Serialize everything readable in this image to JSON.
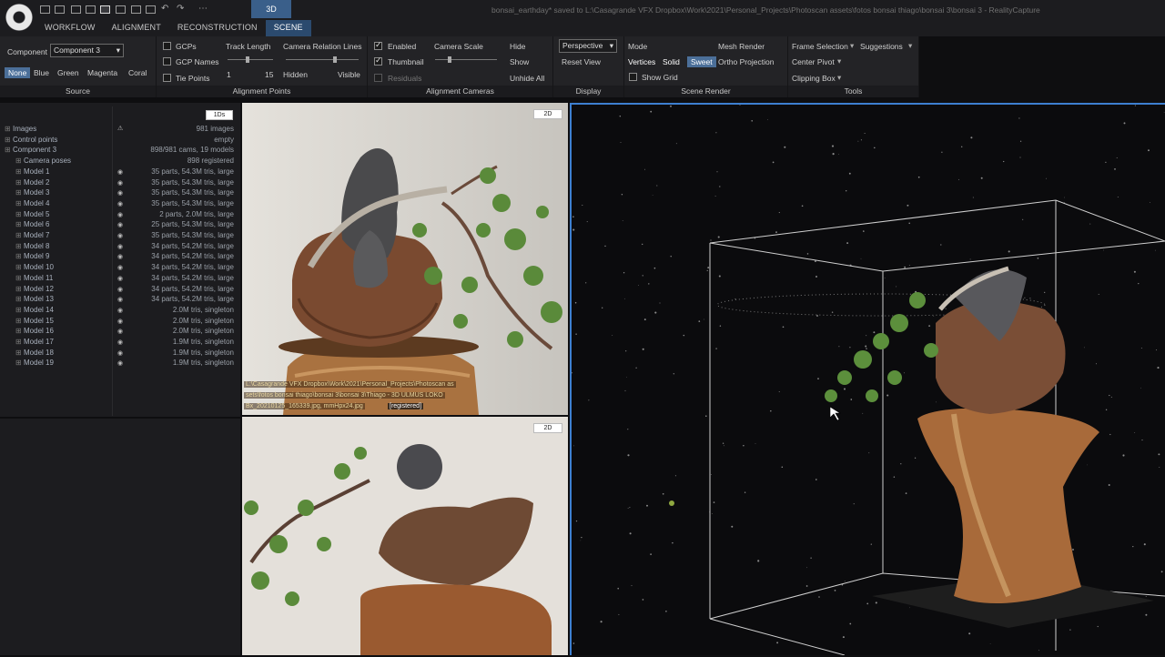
{
  "app": {
    "window_title": "bonsai_earthday* saved to L:\\Casagrande VFX Dropbox\\Work\\2021\\Personal_Projects\\Photoscan assets\\fotos bonsai thiago\\bonsai 3\\bonsai 3 - RealityCapture",
    "tabs": [
      "WORKFLOW",
      "ALIGNMENT",
      "RECONSTRUCTION",
      "SCENE"
    ],
    "active_tab": "SCENE",
    "view_mode": "3D"
  },
  "ribbon": {
    "source": {
      "component_label": "Component",
      "component_value": "Component 3",
      "colors": [
        "None",
        "Blue",
        "Green",
        "Magenta",
        "Coral"
      ],
      "group_label": "Source"
    },
    "alignment_points": {
      "gcps": "GCPs",
      "gcp_names": "GCP Names",
      "tie_points": "Tie Points",
      "track_length": "Track Length",
      "track_min": "1",
      "track_max": "15",
      "camera_relation_lines": "Camera Relation Lines",
      "hidden": "Hidden",
      "visible": "Visible",
      "group_label": "Alignment Points"
    },
    "alignment_cameras": {
      "enabled": "Enabled",
      "thumbnail": "Thumbnail",
      "residuals": "Residuals",
      "camera_scale": "Camera Scale",
      "hide": "Hide",
      "show": "Show",
      "unhide_all": "Unhide All",
      "group_label": "Alignment Cameras"
    },
    "display": {
      "projection": "Perspective",
      "reset_view": "Reset View",
      "group_label": "Display"
    },
    "scene_render": {
      "mode": "Mode",
      "mesh_render": "Mesh Render",
      "vertices": "Vertices",
      "solid": "Solid",
      "sweet": "Sweet",
      "ortho_projection": "Ortho Projection",
      "show_grid": "Show Grid",
      "group_label": "Scene Render"
    },
    "tools": {
      "frame_selection": "Frame Selection",
      "suggestions": "Suggestions",
      "center_pivot": "Center Pivot",
      "clipping_box": "Clipping Box",
      "group_label": "Tools"
    }
  },
  "tree": {
    "badge": "1Ds",
    "rows": [
      {
        "label": "Images",
        "value": "981 images"
      },
      {
        "label": "Control points",
        "value": "empty"
      },
      {
        "label": "Component 3",
        "value": "898/981 cams, 19 models"
      },
      {
        "label": "Camera poses",
        "value": "898 registered"
      },
      {
        "label": "Model 1",
        "value": "35 parts, 54.3M tris, large"
      },
      {
        "label": "Model 2",
        "value": "35 parts, 54.3M tris, large"
      },
      {
        "label": "Model 3",
        "value": "35 parts, 54.3M tris, large"
      },
      {
        "label": "Model 4",
        "value": "35 parts, 54.3M tris, large"
      },
      {
        "label": "Model 5",
        "value": "2 parts, 2.0M tris, large"
      },
      {
        "label": "Model 6",
        "value": "25 parts, 54.3M tris, large"
      },
      {
        "label": "Model 7",
        "value": "35 parts, 54.3M tris, large"
      },
      {
        "label": "Model 8",
        "value": "34 parts, 54.2M tris, large"
      },
      {
        "label": "Model 9",
        "value": "34 parts, 54.2M tris, large"
      },
      {
        "label": "Model 10",
        "value": "34 parts, 54.2M tris, large"
      },
      {
        "label": "Model 11",
        "value": "34 parts, 54.2M tris, large"
      },
      {
        "label": "Model 12",
        "value": "34 parts, 54.2M tris, large"
      },
      {
        "label": "Model 13",
        "value": "34 parts, 54.2M tris, large"
      },
      {
        "label": "Model 14",
        "value": "2.0M tris, singleton"
      },
      {
        "label": "Model 15",
        "value": "2.0M tris, singleton"
      },
      {
        "label": "Model 16",
        "value": "2.0M tris, singleton"
      },
      {
        "label": "Model 17",
        "value": "1.9M tris, singleton"
      },
      {
        "label": "Model 18",
        "value": "1.9M tris, singleton"
      },
      {
        "label": "Model 19",
        "value": "1.9M tris, singleton"
      }
    ]
  },
  "viewports": {
    "top_2d_badge": "2D",
    "bottom_2d_badge": "2D",
    "image_path_line1": "L:\\Casagrande VFX Dropbox\\Work\\2021\\Personal_Projects\\Photoscan as",
    "image_path_line2": "sets\\fotos bonsai thiago\\bonsai 3\\bonsai 3\\Thiago - 3D ULMUS LOKO",
    "image_path_line3": "Bx_20210125_165339.jpg, mmHpx24.jpg",
    "image_status": "[registered]"
  },
  "colors": {
    "accent": "#3d7fd0",
    "active_tab": "#2b4a6e",
    "selected_button": "#4b6f99"
  }
}
